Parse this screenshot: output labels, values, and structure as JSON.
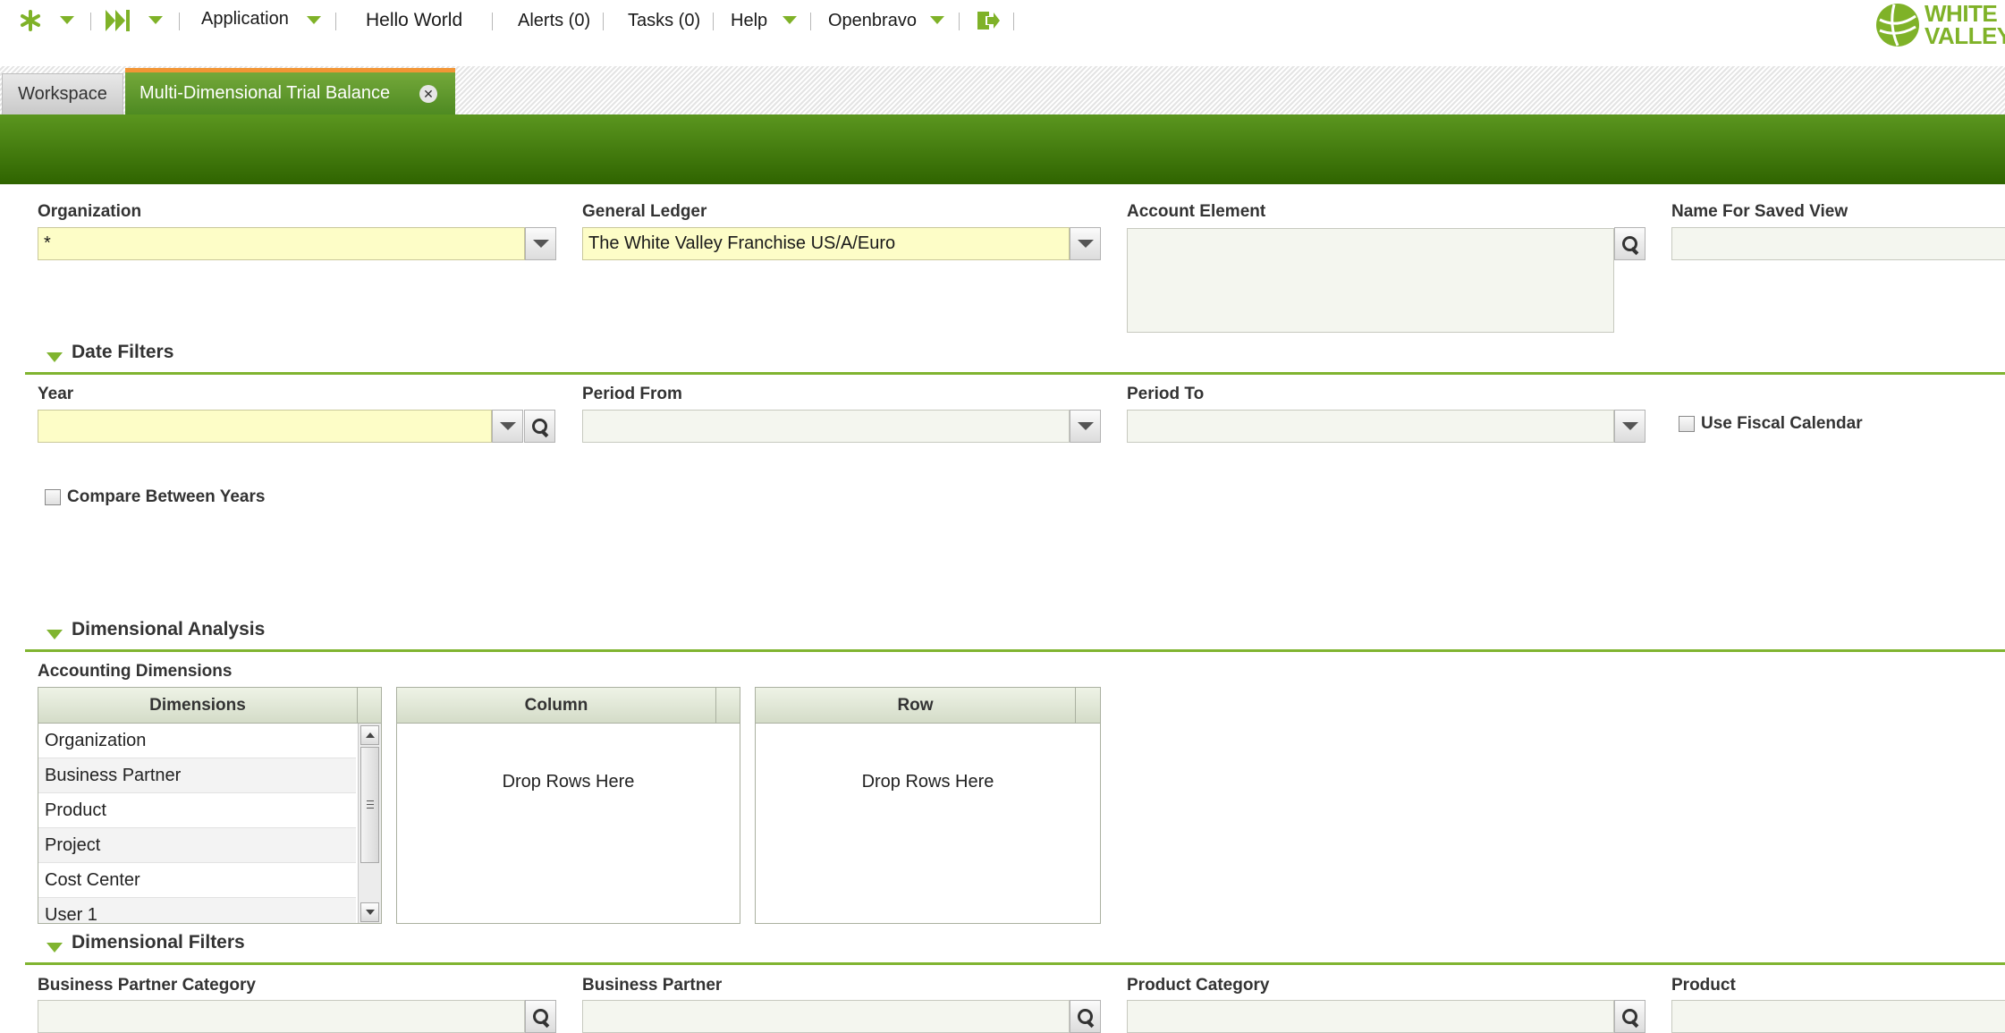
{
  "nav": {
    "application_label": "Application",
    "hello_world": "Hello World",
    "alerts": "Alerts (0)",
    "tasks": "Tasks (0)",
    "help": "Help",
    "user": "Openbravo",
    "logo_line1": "WHITE",
    "logo_line2": "VALLEY",
    "accent_color": "#7fb228"
  },
  "tabs": {
    "workspace": "Workspace",
    "active": "Multi-Dimensional Trial Balance",
    "active_color": "#5b961f",
    "active_top_color": "#f29636"
  },
  "form": {
    "organization": {
      "label": "Organization",
      "value": "*"
    },
    "general_ledger": {
      "label": "General Ledger",
      "value": "The White Valley Franchise US/A/Euro"
    },
    "account_element": {
      "label": "Account Element",
      "value": ""
    },
    "saved_view_name": {
      "label": "Name For Saved View",
      "value": ""
    }
  },
  "date_filters": {
    "title": "Date Filters",
    "year": {
      "label": "Year",
      "value": ""
    },
    "period_from": {
      "label": "Period From",
      "value": ""
    },
    "period_to": {
      "label": "Period To",
      "value": ""
    },
    "use_fiscal_calendar": {
      "label": "Use Fiscal Calendar",
      "checked": false
    },
    "compare_between_years": {
      "label": "Compare Between Years",
      "checked": false
    }
  },
  "dimensional_analysis": {
    "title": "Dimensional Analysis",
    "subtitle": "Accounting Dimensions",
    "dimensions_grid": {
      "header": "Dimensions",
      "rows": [
        "Organization",
        "Business Partner",
        "Product",
        "Project",
        "Cost Center",
        "User 1"
      ]
    },
    "column_grid": {
      "header": "Column",
      "empty_message": "Drop Rows Here"
    },
    "row_grid": {
      "header": "Row",
      "empty_message": "Drop Rows Here"
    }
  },
  "dimensional_filters": {
    "title": "Dimensional Filters",
    "business_partner_category": {
      "label": "Business Partner Category"
    },
    "business_partner": {
      "label": "Business Partner"
    },
    "product_category": {
      "label": "Product Category"
    },
    "product": {
      "label": "Product"
    }
  }
}
